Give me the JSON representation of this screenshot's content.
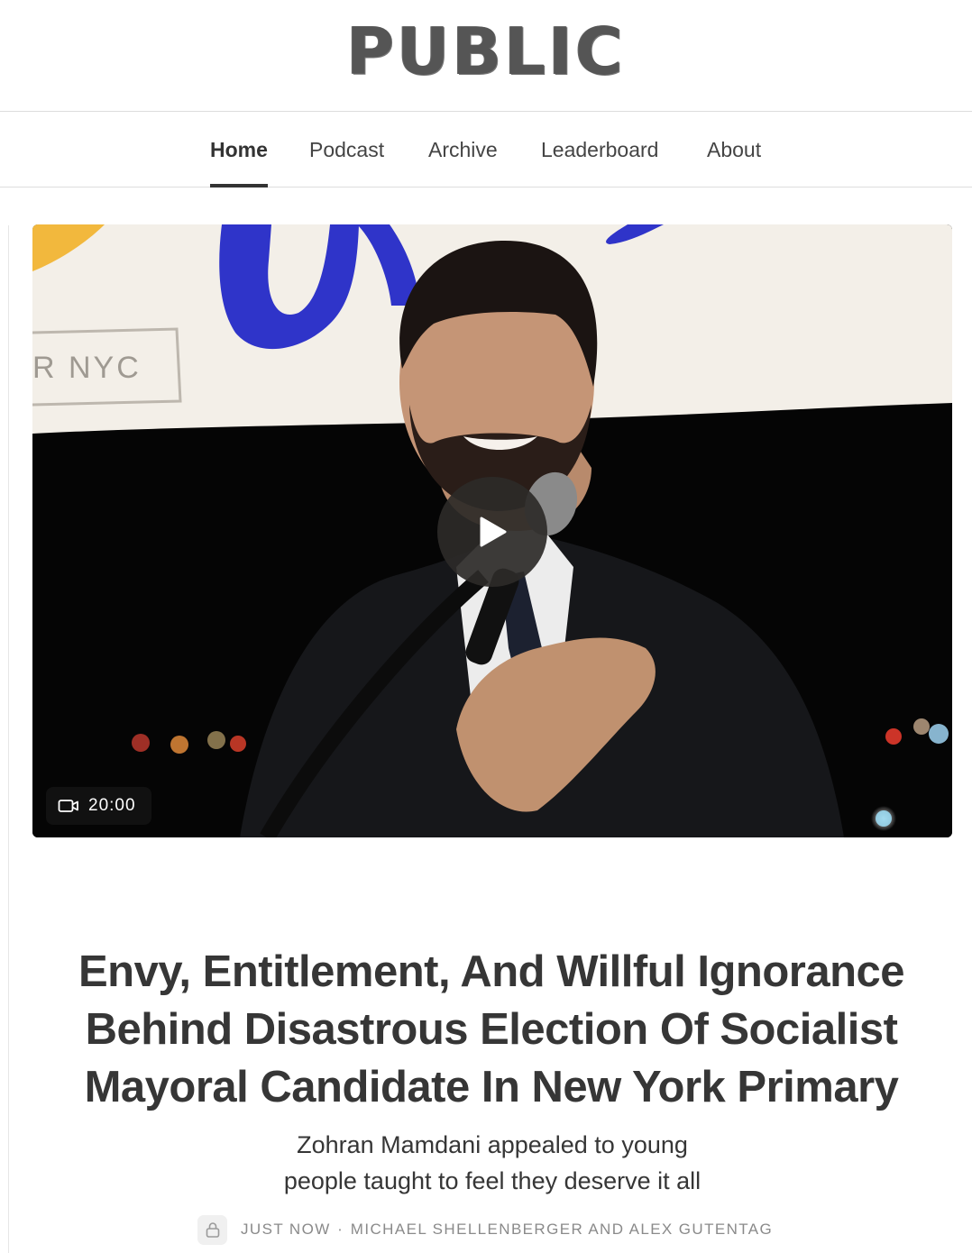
{
  "header": {
    "logo_text": "PUBLIC"
  },
  "nav": {
    "items": [
      {
        "label": "Home",
        "active": true
      },
      {
        "label": "Podcast"
      },
      {
        "label": "Archive"
      },
      {
        "label": "Leaderboard"
      },
      {
        "label": "About"
      }
    ]
  },
  "hero": {
    "banner_text": "R NYC",
    "video_duration": "20:00",
    "play_icon": "play-icon",
    "duration_icon": "video-camera-icon"
  },
  "post": {
    "title": "Envy, Entitlement, And Willful Ignorance Behind Disastrous Election Of Socialist Mayoral Candidate In New York Primary",
    "subtitle_line1": "Zohran Mamdani appealed to young",
    "subtitle_line2": "people taught to feel they deserve it all",
    "time": "JUST NOW",
    "separator": "∙",
    "authors": "MICHAEL SHELLENBERGER AND ALEX GUTENTAG",
    "lock_icon": "lock-icon"
  },
  "colors": {
    "text": "#333333",
    "meta": "#8a8a8a",
    "divider": "#dddddd",
    "banner_blue": "#2f34c9",
    "banner_yellow": "#f2b83d"
  }
}
